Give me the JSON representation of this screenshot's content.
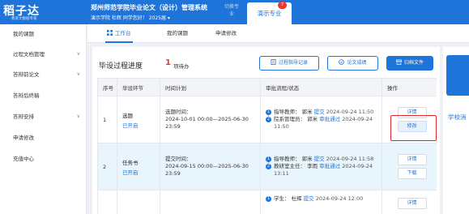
{
  "header": {
    "logo_text": "稻子达",
    "logo_tagline": "教育大数据专家",
    "system_title": "郑州师范学院毕业论文（设计）管理系统",
    "user_info": "演示学院  杜辉  同学您好！   2025届 ▾",
    "switch_major": "切换专业",
    "demo_tab": "演示专业",
    "demo_badge": "7"
  },
  "sidebar": {
    "items": [
      {
        "label": "我的课题",
        "has_chevron": false
      },
      {
        "label": "过程文档管理",
        "has_chevron": true
      },
      {
        "label": "答辩前论文",
        "has_chevron": true
      },
      {
        "label": "答辩后终稿",
        "has_chevron": false
      },
      {
        "label": "答辩安排",
        "has_chevron": true
      },
      {
        "label": "申请修改",
        "has_chevron": false
      },
      {
        "label": "充值中心",
        "has_chevron": false
      }
    ]
  },
  "tabs": [
    {
      "label": "工作台",
      "active": true
    },
    {
      "label": "我的课题",
      "active": false
    },
    {
      "label": "申请修改",
      "active": false
    }
  ],
  "main": {
    "title": "毕设过程进度",
    "pending_count": "1",
    "pending_label": "项待办",
    "buttons": {
      "guidance": "过程指导记录",
      "grades": "论文成绩",
      "archive": "归档文件"
    },
    "table": {
      "headers": [
        "序号",
        "毕设环节",
        "时间计划",
        "审批流程/状态",
        "操作"
      ],
      "rows": [
        {
          "index": "1",
          "stage": "选题",
          "status": "已开启",
          "plan_label": "选题时间：",
          "plan_range": "2024-10-01 00:00—2025-06-30",
          "plan_end": "23:59",
          "flow": [
            {
              "num": "1",
              "role": "指导教师：",
              "name": "郭米",
              "action": "提交",
              "time": "2024-09-24 11:50"
            },
            {
              "num": "2",
              "role": "院系管理员：",
              "name": "郭米",
              "action": "审批通过",
              "time": "2024-09-24 11:50"
            }
          ],
          "ops": [
            "详情",
            "修改"
          ]
        },
        {
          "index": "2",
          "stage": "任务书",
          "status": "已开启",
          "plan_label": "提交时间：",
          "plan_range": "2024-09-15 00:00—2025-06-30",
          "plan_end": "23:59",
          "flow": [
            {
              "num": "1",
              "role": "指导教师：",
              "name": "郭米",
              "action": "提交",
              "time": "2024-09-24 11:58"
            },
            {
              "num": "2",
              "role": "教研室主任：",
              "name": "李雨",
              "action": "审批通过",
              "time": "2024-09-24 13:11"
            }
          ],
          "ops": [
            "详情",
            "下载"
          ]
        },
        {
          "index": "",
          "stage": "",
          "status": "",
          "flow": [
            {
              "num": "1",
              "role": "学生：",
              "name": "杜辉",
              "action": "提交",
              "time": "2024-09-24 12:00"
            }
          ],
          "ops": [
            "详情"
          ]
        }
      ]
    }
  },
  "right_card": {
    "text": "学校消"
  },
  "colors": {
    "brand_blue": "#1e74d9",
    "badge_red": "#f0352d",
    "highlight_red": "#e02a2a"
  }
}
